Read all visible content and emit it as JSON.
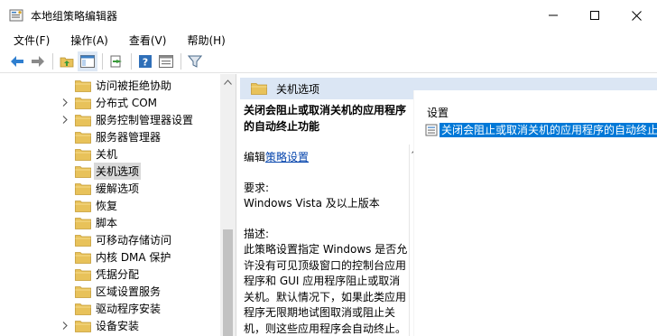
{
  "window": {
    "title": "本地组策略编辑器"
  },
  "menu": [
    "文件(F)",
    "操作(A)",
    "查看(V)",
    "帮助(H)"
  ],
  "toolbar": {
    "buttons": [
      "back-icon",
      "forward-icon",
      "up-folder-icon",
      "show-hide-tree-icon",
      "export-icon",
      "help-icon",
      "properties-icon",
      "filter-icon"
    ]
  },
  "tree": {
    "items": [
      {
        "label": "访问被拒绝协助",
        "expandable": false
      },
      {
        "label": "分布式 COM",
        "expandable": true
      },
      {
        "label": "服务控制管理器设置",
        "expandable": true
      },
      {
        "label": "服务器管理器",
        "expandable": false
      },
      {
        "label": "关机",
        "expandable": false
      },
      {
        "label": "关机选项",
        "expandable": false,
        "selected": true
      },
      {
        "label": "缓解选项",
        "expandable": false
      },
      {
        "label": "恢复",
        "expandable": false
      },
      {
        "label": "脚本",
        "expandable": false
      },
      {
        "label": "可移动存储访问",
        "expandable": false
      },
      {
        "label": "内核 DMA 保护",
        "expandable": false
      },
      {
        "label": "凭据分配",
        "expandable": false
      },
      {
        "label": "区域设置服务",
        "expandable": false
      },
      {
        "label": "驱动程序安装",
        "expandable": false
      },
      {
        "label": "设备安装",
        "expandable": true
      }
    ]
  },
  "right": {
    "header": "关机选项",
    "desc_title": "关闭会阻止或取消关机的应用程序的自动终止功能",
    "edit_prefix": "编辑",
    "edit_link": "策略设置",
    "requirements_label": "要求:",
    "requirements_value": "Windows Vista 及以上版本",
    "description_label": "描述:",
    "description_text": "此策略设置指定 Windows 是否允许没有可见顶级窗口的控制台应用程序和 GUI 应用程序阻止或取消关机。默认情况下，如果此类应用程序无限期地试图取消或阻止关机，则这些应用程序会自动终止。",
    "list_header": "设置",
    "list_item": "关闭会阻止或取消关机的应用程序的自动终止功"
  },
  "colors": {
    "selection": "#0078d7",
    "header_band": "#dbe6f4",
    "folder": "#e8c25a"
  }
}
